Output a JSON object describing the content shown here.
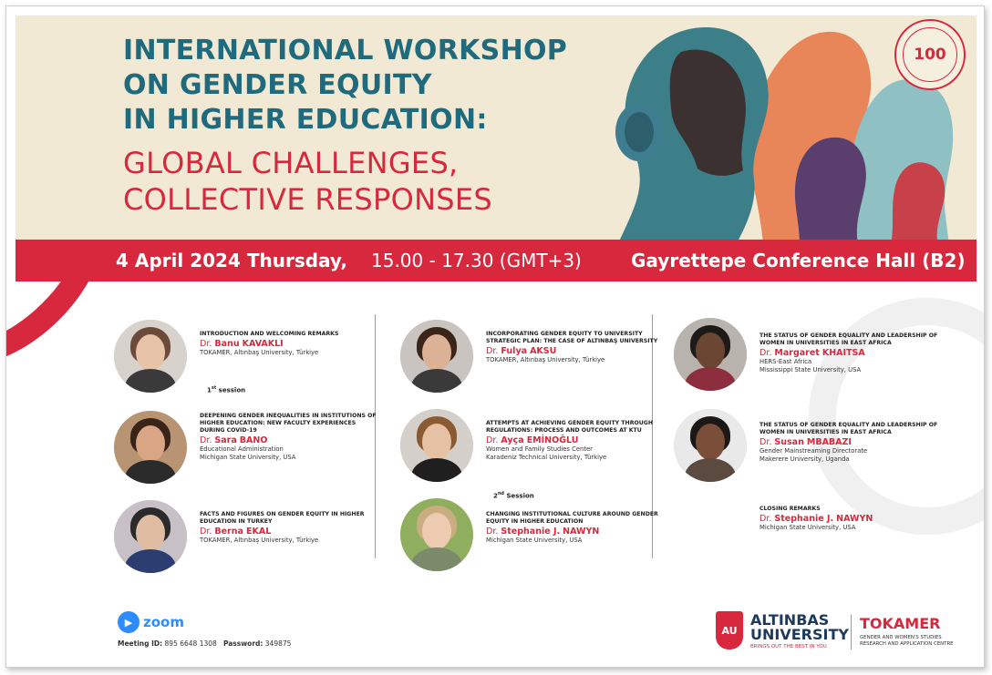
{
  "banner": {
    "title_lines": [
      "INTERNATIONAL WORKSHOP",
      "ON GENDER EQUITY",
      "IN HIGHER EDUCATION:"
    ],
    "subtitle_lines": [
      "GLOBAL CHALLENGES,",
      "COLLECTIVE RESPONSES"
    ],
    "seal_text": "100"
  },
  "strip": {
    "date": "4 April 2024 Thursday,",
    "time": "15.00 - 17.30 (GMT+3)",
    "venue": "Gayrettepe Conference Hall (B2)"
  },
  "sessions": {
    "first": "1",
    "first_sup": "st",
    "first_word": " session",
    "second": "2",
    "second_sup": "nd",
    "second_word": " Session"
  },
  "speakers": [
    {
      "topic": "INTRODUCTION AND WELCOMING REMARKS",
      "title": "Dr.",
      "first": "Banu",
      "last": "KAVAKLI",
      "aff1": "TOKAMER, Altınbaş University, Türkiye",
      "aff2": ""
    },
    {
      "topic": "DEEPENING GENDER INEQUALITIES IN INSTITUTIONS OF HIGHER EDUCATION: NEW FACULTY EXPERIENCES DURING COVID-19",
      "title": "Dr.",
      "first": "Sara",
      "last": "BANO",
      "aff1": "Educational Administration",
      "aff2": "Michigan State University, USA"
    },
    {
      "topic": "FACTS AND FIGURES ON GENDER EQUITY IN HIGHER EDUCATION IN TURKEY",
      "title": "Dr.",
      "first": "Berna",
      "last": "EKAL",
      "aff1": "TOKAMER, Altınbaş University, Türkiye",
      "aff2": ""
    },
    {
      "topic": "INCORPORATING GENDER EQUITY TO UNIVERSITY STRATEGIC PLAN: THE CASE OF ALTINBAŞ UNIVERSITY",
      "title": "Dr.",
      "first": "Fulya",
      "last": "AKSU",
      "aff1": "TOKAMER, Altınbaş University, Türkiye",
      "aff2": ""
    },
    {
      "topic": "ATTEMPTS AT ACHIEVING GENDER EQUITY THROUGH REGULATIONS: PROCESS AND OUTCOMES AT KTU",
      "title": "Dr.",
      "first": "Ayça",
      "last": "EMİNOĞLU",
      "aff1": "Women and Family Studies Center",
      "aff2": "Karadeniz Technical University, Türkiye"
    },
    {
      "topic": "CHANGING INSTITUTIONAL CULTURE AROUND GENDER EQUITY IN HIGHER EDUCATION",
      "title": "Dr.",
      "first": "Stephanie J.",
      "last": "NAWYN",
      "aff1": "Michigan State University, USA",
      "aff2": ""
    },
    {
      "topic": "THE STATUS OF GENDER EQUALITY AND LEADERSHIP OF WOMEN IN UNIVERSITIES IN EAST AFRICA",
      "title": "Dr.",
      "first": "Margaret",
      "last": "KHAITSA",
      "aff1": "HERS-East Africa",
      "aff2": "Mississippi State University, USA"
    },
    {
      "topic": "THE STATUS OF GENDER EQUALITY AND LEADERSHIP OF WOMEN IN UNIVERSITIES IN EAST AFRICA",
      "title": "Dr.",
      "first": "Susan",
      "last": "MBABAZI",
      "aff1": "Gender Mainstreaming Directorate",
      "aff2": "Makerere University, Uganda"
    },
    {
      "topic": "CLOSING REMARKS",
      "title": "Dr.",
      "first": "Stephanie J.",
      "last": "NAWYN",
      "aff1": "Michigan State University, USA",
      "aff2": ""
    }
  ],
  "footer": {
    "zoom": "zoom",
    "meeting_label": "Meeting ID:",
    "meeting_id": "895 6648 1308",
    "password_label": "Password:",
    "password": "349875",
    "au_line1": "ALTINBAS",
    "au_line2": "UNIVERSITY",
    "au_tagline": "BRINGS OUT THE BEST IN YOU",
    "au_shield": "AU",
    "tokamer": "TOKAMER",
    "tokamer_sub1": "GENDER AND WOMEN'S STUDIES",
    "tokamer_sub2": "RESEARCH AND APPLICATION CENTRE"
  },
  "colors": {
    "teal": "#1f6b7d",
    "red": "#d8283d",
    "cream": "#f1e9d3",
    "zoom_blue": "#2d8cff"
  }
}
